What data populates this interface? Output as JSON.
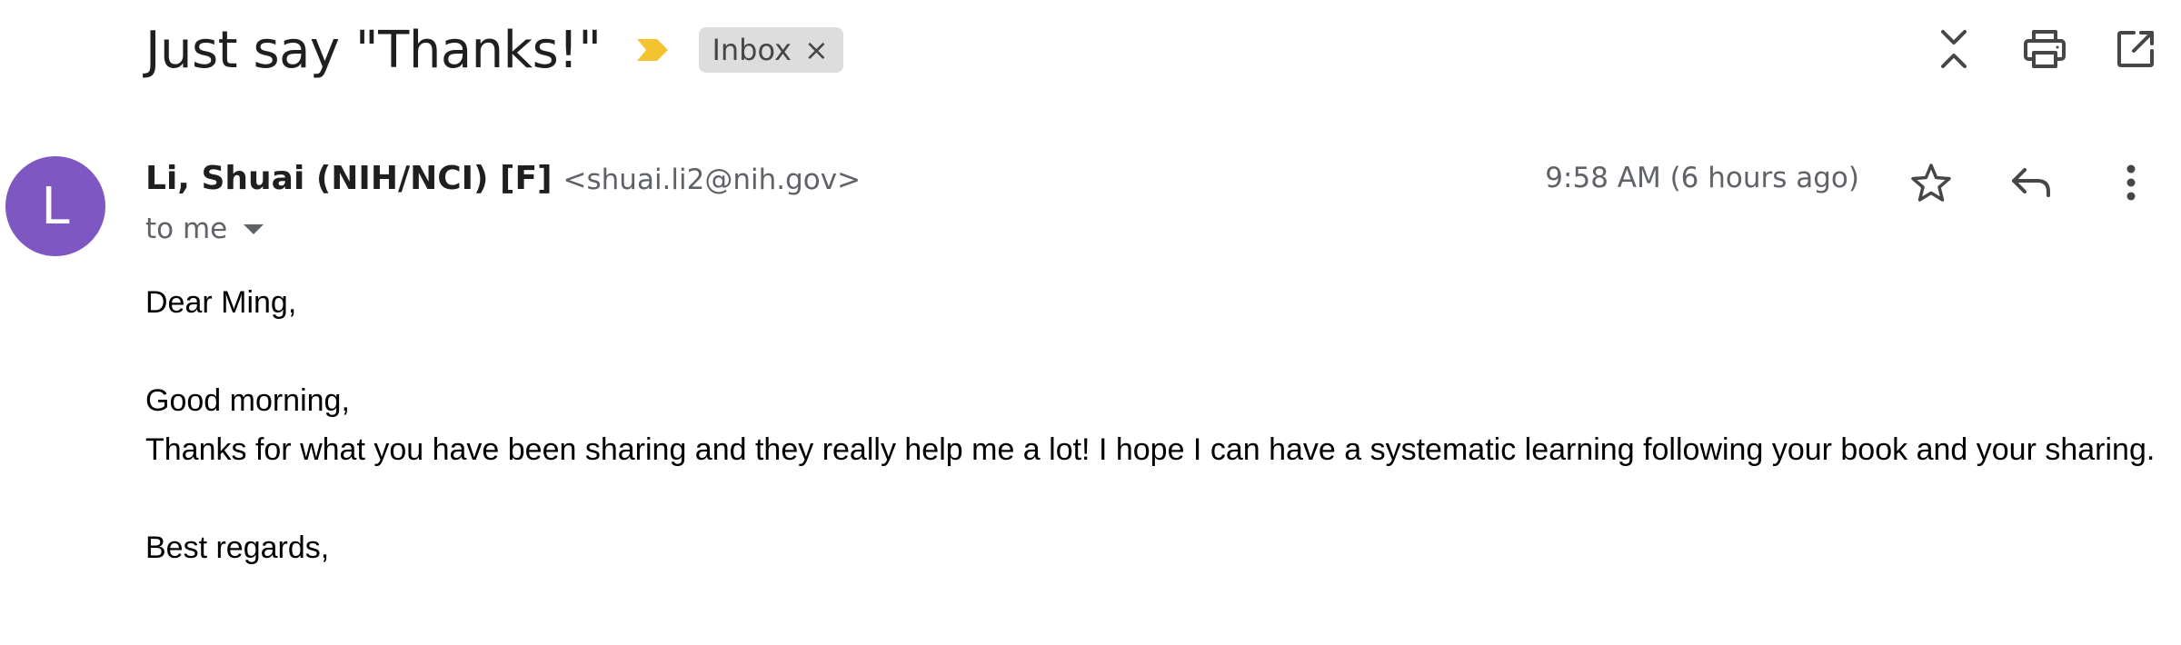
{
  "subject": {
    "title": "Just say \"Thanks!\"",
    "importance_icon": "importance-marker-icon",
    "importance_color": "#f4c430",
    "label": "Inbox",
    "label_remove": "×"
  },
  "header_actions": [
    {
      "name": "collapse-all-icon"
    },
    {
      "name": "print-icon"
    },
    {
      "name": "open-in-new-window-icon"
    }
  ],
  "sender": {
    "avatar_letter": "L",
    "avatar_color": "#7e57c2",
    "name": "Li, Shuai (NIH/NCI) [F]",
    "email": "<shuai.li2@nih.gov>",
    "recipient": "to me"
  },
  "timestamp": "9:58 AM (6 hours ago)",
  "message_actions": [
    {
      "name": "star-icon"
    },
    {
      "name": "reply-icon"
    },
    {
      "name": "more-options-icon"
    }
  ],
  "body": {
    "greeting": "Dear Ming,",
    "salutation": "Good morning,",
    "paragraph": "Thanks for what you have been sharing and they really help me a lot! I hope I can have a systematic learning following your book and your sharing.",
    "closing": "Best regards,"
  }
}
